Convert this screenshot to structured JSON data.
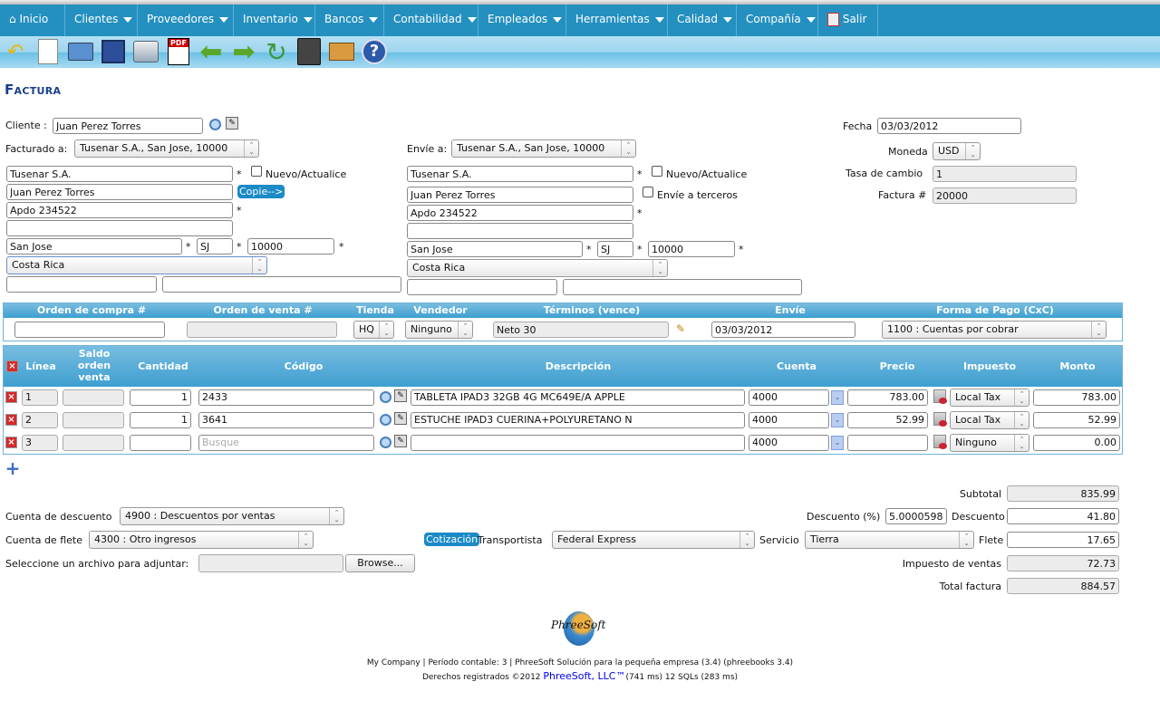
{
  "menu": {
    "items": [
      {
        "label": "Inicio",
        "icon": "home-icon"
      },
      {
        "label": "Clientes"
      },
      {
        "label": "Proveedores"
      },
      {
        "label": "Inventario"
      },
      {
        "label": "Bancos"
      },
      {
        "label": "Contabilidad"
      },
      {
        "label": "Empleados"
      },
      {
        "label": "Herramientas"
      },
      {
        "label": "Calidad"
      },
      {
        "label": "Compañía"
      },
      {
        "label": "Salir",
        "icon": "exit-icon"
      }
    ]
  },
  "toolbar": {
    "icons": [
      "undo-icon",
      "new-document-icon",
      "open-folder-icon",
      "save-icon",
      "print-icon",
      "pdf-icon",
      "previous-arrow-icon",
      "next-arrow-icon",
      "recur-icon",
      "calculator-icon",
      "package-icon",
      "help-icon"
    ]
  },
  "page_title": "Factura",
  "form": {
    "cliente_label": "Cliente :",
    "cliente": "Juan Perez Torres",
    "facturado_label": "Facturado a:",
    "facturado": "Tusenar S.A., San Jose, 10000",
    "envie_label": "Envíe a:",
    "envie": "Tusenar S.A., San Jose, 10000",
    "fecha_label": "Fecha",
    "fecha": "03/03/2012",
    "moneda_label": "Moneda",
    "moneda": "USD",
    "tasa_label": "Tasa de cambio",
    "tasa": "1",
    "factura_label": "Factura #",
    "factura": "20000",
    "nuevo_label": "Nuevo/Actualice",
    "terceros_label": "Envíe a terceros",
    "copy_label": "Copie-->",
    "required": "*",
    "bill": {
      "company": "Tusenar S.A.",
      "contact": "Juan Perez Torres",
      "address1": "Apdo 234522",
      "address2": "",
      "city": "San Jose",
      "state": "SJ",
      "zip": "10000",
      "country": "Costa Rica",
      "phone": "",
      "email": ""
    },
    "ship": {
      "company": "Tusenar S.A.",
      "contact": "Juan Perez Torres",
      "address1": "Apdo 234522",
      "address2": "",
      "city": "San Jose",
      "state": "SJ",
      "zip": "10000",
      "country": "Costa Rica",
      "phone": "",
      "email": ""
    }
  },
  "order": {
    "headers": [
      "Orden de compra #",
      "Orden de venta #",
      "Tienda",
      "Vendedor",
      "Términos (vence)",
      "Envíe",
      "Forma de Pago (CxC)"
    ],
    "po": "",
    "so": "",
    "tienda": "HQ",
    "vendedor": "Ninguno",
    "terminos": "Neto 30",
    "envie": "03/03/2012",
    "forma_pago": "1100 : Cuentas por cobrar"
  },
  "lines": {
    "headers": {
      "linea": "Línea",
      "saldo": "Saldo orden venta",
      "cantidad": "Cantidad",
      "codigo": "Código",
      "descripcion": "Descripción",
      "cuenta": "Cuenta",
      "precio": "Precio",
      "impuesto": "Impuesto",
      "monto": "Monto"
    },
    "code_placeholder": "Busque",
    "rows": [
      {
        "linea": "1",
        "saldo": "",
        "cantidad": "1",
        "codigo": "2433",
        "descripcion": "TABLETA IPAD3 32GB 4G MC649E/A APPLE",
        "cuenta": "4000",
        "precio": "783.00",
        "impuesto": "Local Tax",
        "monto": "783.00"
      },
      {
        "linea": "2",
        "saldo": "",
        "cantidad": "1",
        "codigo": "3641",
        "descripcion": "ESTUCHE IPAD3 CUERINA+POLYURETANO N",
        "cuenta": "4000",
        "precio": "52.99",
        "impuesto": "Local Tax",
        "monto": "52.99"
      },
      {
        "linea": "3",
        "saldo": "",
        "cantidad": "",
        "codigo": "",
        "descripcion": "",
        "cuenta": "4000",
        "precio": "",
        "impuesto": "Ninguno",
        "monto": "0.00"
      }
    ]
  },
  "bottom": {
    "desc_cuenta_label": "Cuenta de descuento",
    "desc_cuenta": "4900 : Descuentos por ventas",
    "flete_cuenta_label": "Cuenta de flete",
    "flete_cuenta": "4300 : Otro ingresos",
    "archivo_label": "Seleccione un archivo para adjuntar:",
    "browse_label": "Browse...",
    "cotizacion_label": "Cotización",
    "transportista_label": "Transportista",
    "transportista": "Federal Express",
    "servicio_label": "Servicio",
    "servicio": "Tierra",
    "subtotal_label": "Subtotal",
    "subtotal": "835.99",
    "desc_pct_label": "Descuento (%)",
    "desc_pct": "5.00005980",
    "descuento_label": "Descuento",
    "descuento": "41.80",
    "flete_label": "Flete",
    "flete": "17.65",
    "impuesto_label": "Impuesto de ventas",
    "impuesto": "72.73",
    "total_label": "Total factura",
    "total": "884.57"
  },
  "footer": {
    "logo_text": "PhreeSoft",
    "line1": "My Company | Período contable: 3 | PhreeSoft Solución para la pequeña empresa (3.4) (phreebooks 3.4)",
    "line2_prefix": "Derechos registrados ©2012 ",
    "link": "PhreeSoft, LLC™",
    "line2_suffix": "(741 ms) 12 SQLs (283 ms)"
  },
  "colors": {
    "menu": "#2490c0",
    "title": "#1a3e8c",
    "header": "#3e9fd0",
    "button": "#1b8ac7"
  }
}
